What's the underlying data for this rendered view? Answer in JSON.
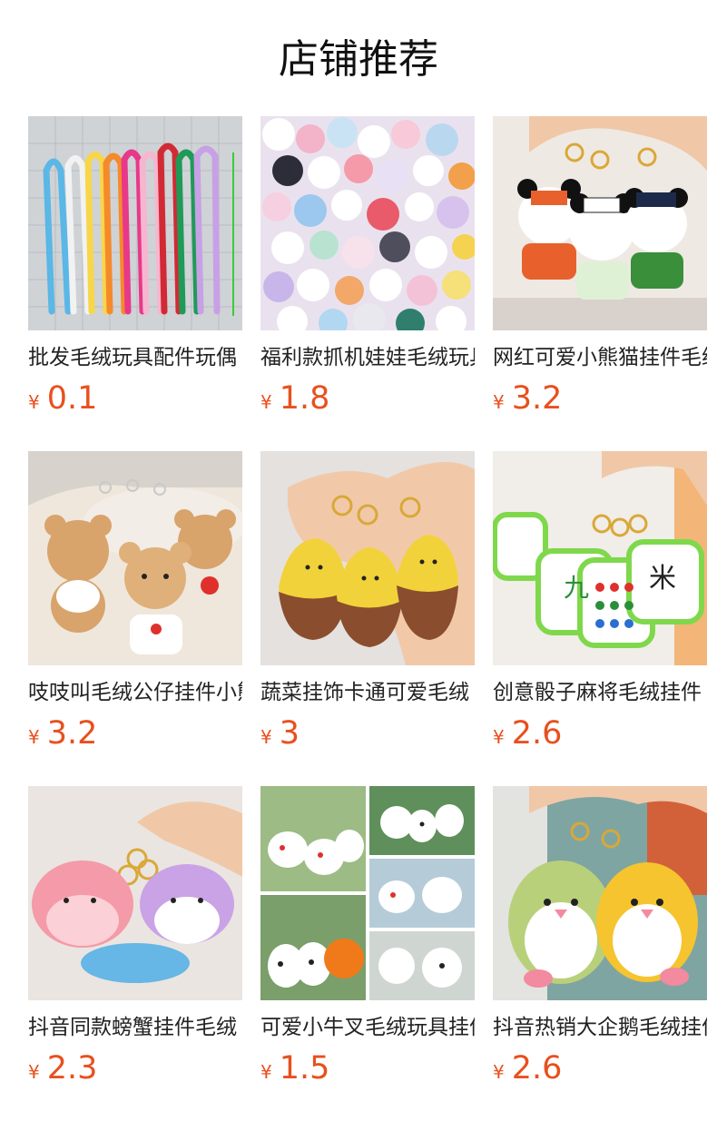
{
  "section_title": "店铺推荐",
  "currency": "¥",
  "products": [
    {
      "name": "批发毛绒玩具配件玩偶",
      "price": "0.1",
      "image": "colorful-lanyard-ropes"
    },
    {
      "name": "福利款抓机娃娃毛绒玩具",
      "price": "1.8",
      "image": "pile-of-plush-toys"
    },
    {
      "name": "网红可爱小熊猫挂件毛绒",
      "price": "3.2",
      "image": "panda-keychains"
    },
    {
      "name": "吱吱叫毛绒公仔挂件小熊",
      "price": "3.2",
      "image": "bear-keychains"
    },
    {
      "name": "蔬菜挂饰卡通可爱毛绒",
      "price": "3",
      "image": "sweet-potato-keychains"
    },
    {
      "name": "创意骰子麻将毛绒挂件",
      "price": "2.6",
      "image": "mahjong-tile-keychains"
    },
    {
      "name": "抖音同款螃蟹挂件毛绒",
      "price": "2.3",
      "image": "axolotl-keychains"
    },
    {
      "name": "可爱小牛叉毛绒玩具挂件",
      "price": "1.5",
      "image": "ghost-and-cow-keychains"
    },
    {
      "name": "抖音热销大企鹅毛绒挂件",
      "price": "2.6",
      "image": "penguin-keychains"
    }
  ]
}
